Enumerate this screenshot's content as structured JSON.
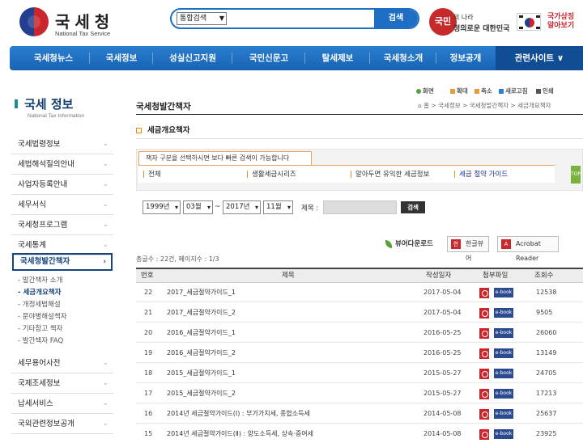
{
  "header": {
    "logo_name": "국세청",
    "logo_sub": "National Tax Service",
    "search": {
      "category": "통합검색",
      "button": "검색"
    },
    "slogan": {
      "badge": "국민",
      "line1": "의 나라",
      "line2": "정의로운 대한민국"
    },
    "national_symbol": {
      "line1": "국가상징",
      "line2": "알아보기"
    }
  },
  "gnb": {
    "items": [
      "국세청뉴스",
      "국세정보",
      "성실신고지원",
      "국민신문고",
      "탈세제보",
      "국세청소개",
      "정보공개"
    ],
    "related": "관련사이트 ∨"
  },
  "lnb": {
    "title": "국세 정보",
    "title_en": "National Tax Information",
    "items": [
      "국세법령정보",
      "세법해석질의안내",
      "사업자등록안내",
      "세무서식",
      "국세청프로그램",
      "국세통계",
      "국세청발간책자"
    ],
    "sub_items": [
      "- 발간책자 소개",
      "- 세금개요책자",
      "- 개정세법해설",
      "- 문야별해설책자",
      "- 기타참고 책자",
      "- 발간책자 FAQ"
    ],
    "bottom_items": [
      "세무용어사전",
      "국제조세정보",
      "납세서비스",
      "국외관련정보공개"
    ]
  },
  "util": {
    "print_screen": "화면",
    "zoom_in": "확대",
    "zoom_out": "축소",
    "refresh": "새로고침",
    "print": "인쇄"
  },
  "page": {
    "title": "국세청발간책자",
    "breadcrumb": "⌂ 홈 > 국세정보 > 국세청발간책자 > 세금개요책자",
    "section": "세금개요책자"
  },
  "filter": {
    "notice": "책자 구분을 선택하시면 보다 빠른 검색이 가능합니다",
    "categories": [
      "전체",
      "생활세금시리즈",
      "알아두면 유익한 세금정보",
      "세금 절약 가이드"
    ],
    "tab": "TOP"
  },
  "date_search": {
    "from_year": "1999년",
    "from_month": "03월",
    "tilde": "~",
    "to_year": "2017년",
    "to_month": "11월",
    "keyword_label": "제목 :",
    "button": "검색"
  },
  "download": {
    "label": "뷰어다운로드",
    "hangul_viewer": "한글뷰어",
    "acrobat": "Acrobat Reader"
  },
  "count": "총글수 : 22건, 페이지수 : 1/3",
  "table": {
    "headers": [
      "번호",
      "제목",
      "작성일자",
      "첨부파일",
      "조회수"
    ],
    "ebook_label": "e-book",
    "rows": [
      {
        "no": "22",
        "title": "2017_세금절약가이드_1",
        "date": "2017-05-04",
        "views": "12538"
      },
      {
        "no": "21",
        "title": "2017_세금절약가이드_2",
        "date": "2017-05-04",
        "views": "9505"
      },
      {
        "no": "20",
        "title": "2016_세금절약가이드_1",
        "date": "2016-05-25",
        "views": "26060"
      },
      {
        "no": "19",
        "title": "2016_세금절약가이드_2",
        "date": "2016-05-25",
        "views": "13149"
      },
      {
        "no": "18",
        "title": "2015_세금절약가이드_1",
        "date": "2015-05-27",
        "views": "24705"
      },
      {
        "no": "17",
        "title": "2015_세금절약가이드_2",
        "date": "2015-05-27",
        "views": "17213"
      },
      {
        "no": "16",
        "title": "2014년 세금절약가이드(Ⅰ) : 부가가치세, 종합소득세",
        "date": "2014-05-08",
        "views": "25637"
      },
      {
        "no": "15",
        "title": "2014년 세금절약가이드(Ⅱ) : 양도소득세, 상속·증여세",
        "date": "2014-05-08",
        "views": "23925"
      }
    ]
  }
}
